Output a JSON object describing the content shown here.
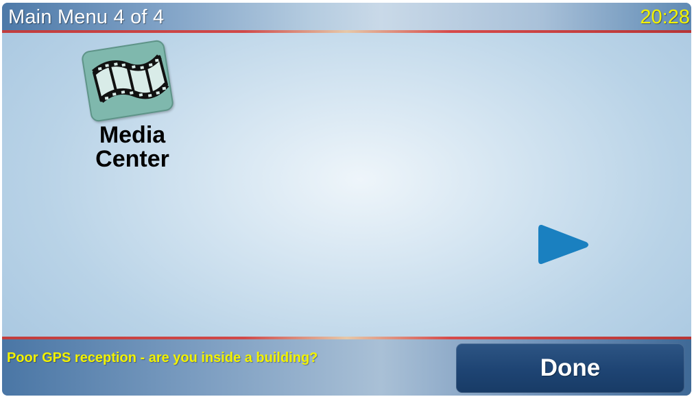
{
  "header": {
    "title": "Main Menu 4  of 4",
    "time": "20:28"
  },
  "menu": {
    "items": [
      {
        "label": "Media\nCenter",
        "icon": "film-strip-icon"
      }
    ],
    "next_icon": "arrow-right-icon"
  },
  "footer": {
    "status": "Poor GPS reception - are you inside a building?",
    "done_label": "Done"
  },
  "colors": {
    "accent_yellow": "#f2f200",
    "done_button": "#1e4473",
    "arrow_blue": "#1a80c0",
    "icon_tile": "#7fb8ad",
    "divider_red": "#c13d3d"
  }
}
